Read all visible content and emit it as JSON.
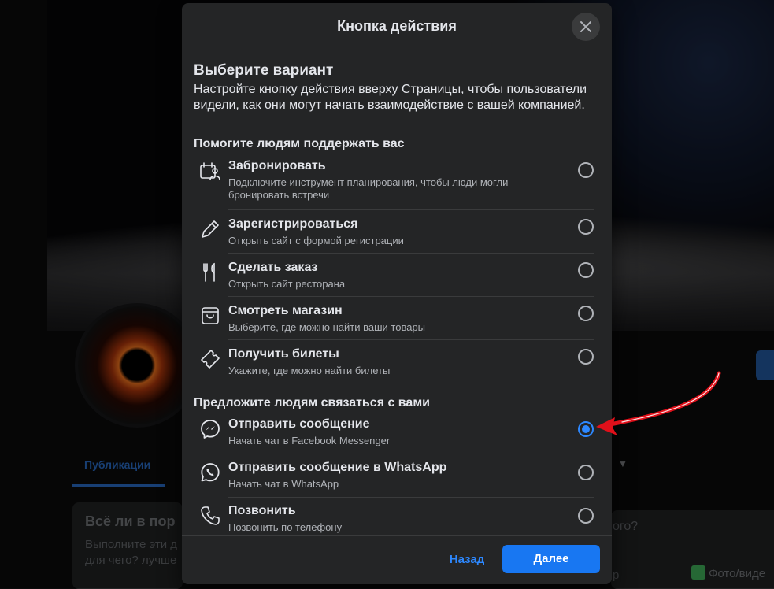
{
  "background_page": {
    "tab_active": "Публикации",
    "card_title": "Всё ли в пор",
    "card_text_1": "Выполните эти д",
    "card_text_2": "для чего? лучше",
    "right_question": "ого?",
    "right_partial": "р",
    "photo_button": "Фото/виде"
  },
  "modal": {
    "title": "Кнопка действия",
    "heading": "Выберите вариант",
    "description": "Настройте кнопку действия вверху Страницы, чтобы пользователи видели, как они могут начать взаимодействие с вашей компанией.",
    "groups": [
      {
        "title": "Помогите людям поддержать вас",
        "options": [
          {
            "label": "Забронировать",
            "sub": "Подключите инструмент планирования, чтобы люди могли бронировать встречи",
            "icon": "calendar-person-icon",
            "selected": false
          },
          {
            "label": "Зарегистрироваться",
            "sub": "Открыть сайт с формой регистрации",
            "icon": "pencil-icon",
            "selected": false
          },
          {
            "label": "Сделать заказ",
            "sub": "Открыть сайт ресторана",
            "icon": "fork-knife-icon",
            "selected": false
          },
          {
            "label": "Смотреть магазин",
            "sub": "Выберите, где можно найти ваши товары",
            "icon": "shopping-bag-icon",
            "selected": false
          },
          {
            "label": "Получить билеты",
            "sub": "Укажите, где можно найти билеты",
            "icon": "ticket-icon",
            "selected": false
          }
        ]
      },
      {
        "title": "Предложите людям связаться с вами",
        "options": [
          {
            "label": "Отправить сообщение",
            "sub": "Начать чат в Facebook Messenger",
            "icon": "messenger-icon",
            "selected": true
          },
          {
            "label": "Отправить сообщение в WhatsApp",
            "sub": "Начать чат в WhatsApp",
            "icon": "whatsapp-icon",
            "selected": false
          },
          {
            "label": "Позвонить",
            "sub": "Позвонить по телефону",
            "icon": "phone-icon",
            "selected": false
          }
        ]
      }
    ],
    "back_label": "Назад",
    "next_label": "Далее"
  },
  "colors": {
    "accent": "#1877f2",
    "link": "#2d88ff",
    "modal_bg": "#242526",
    "arrow": "#e0101a"
  }
}
